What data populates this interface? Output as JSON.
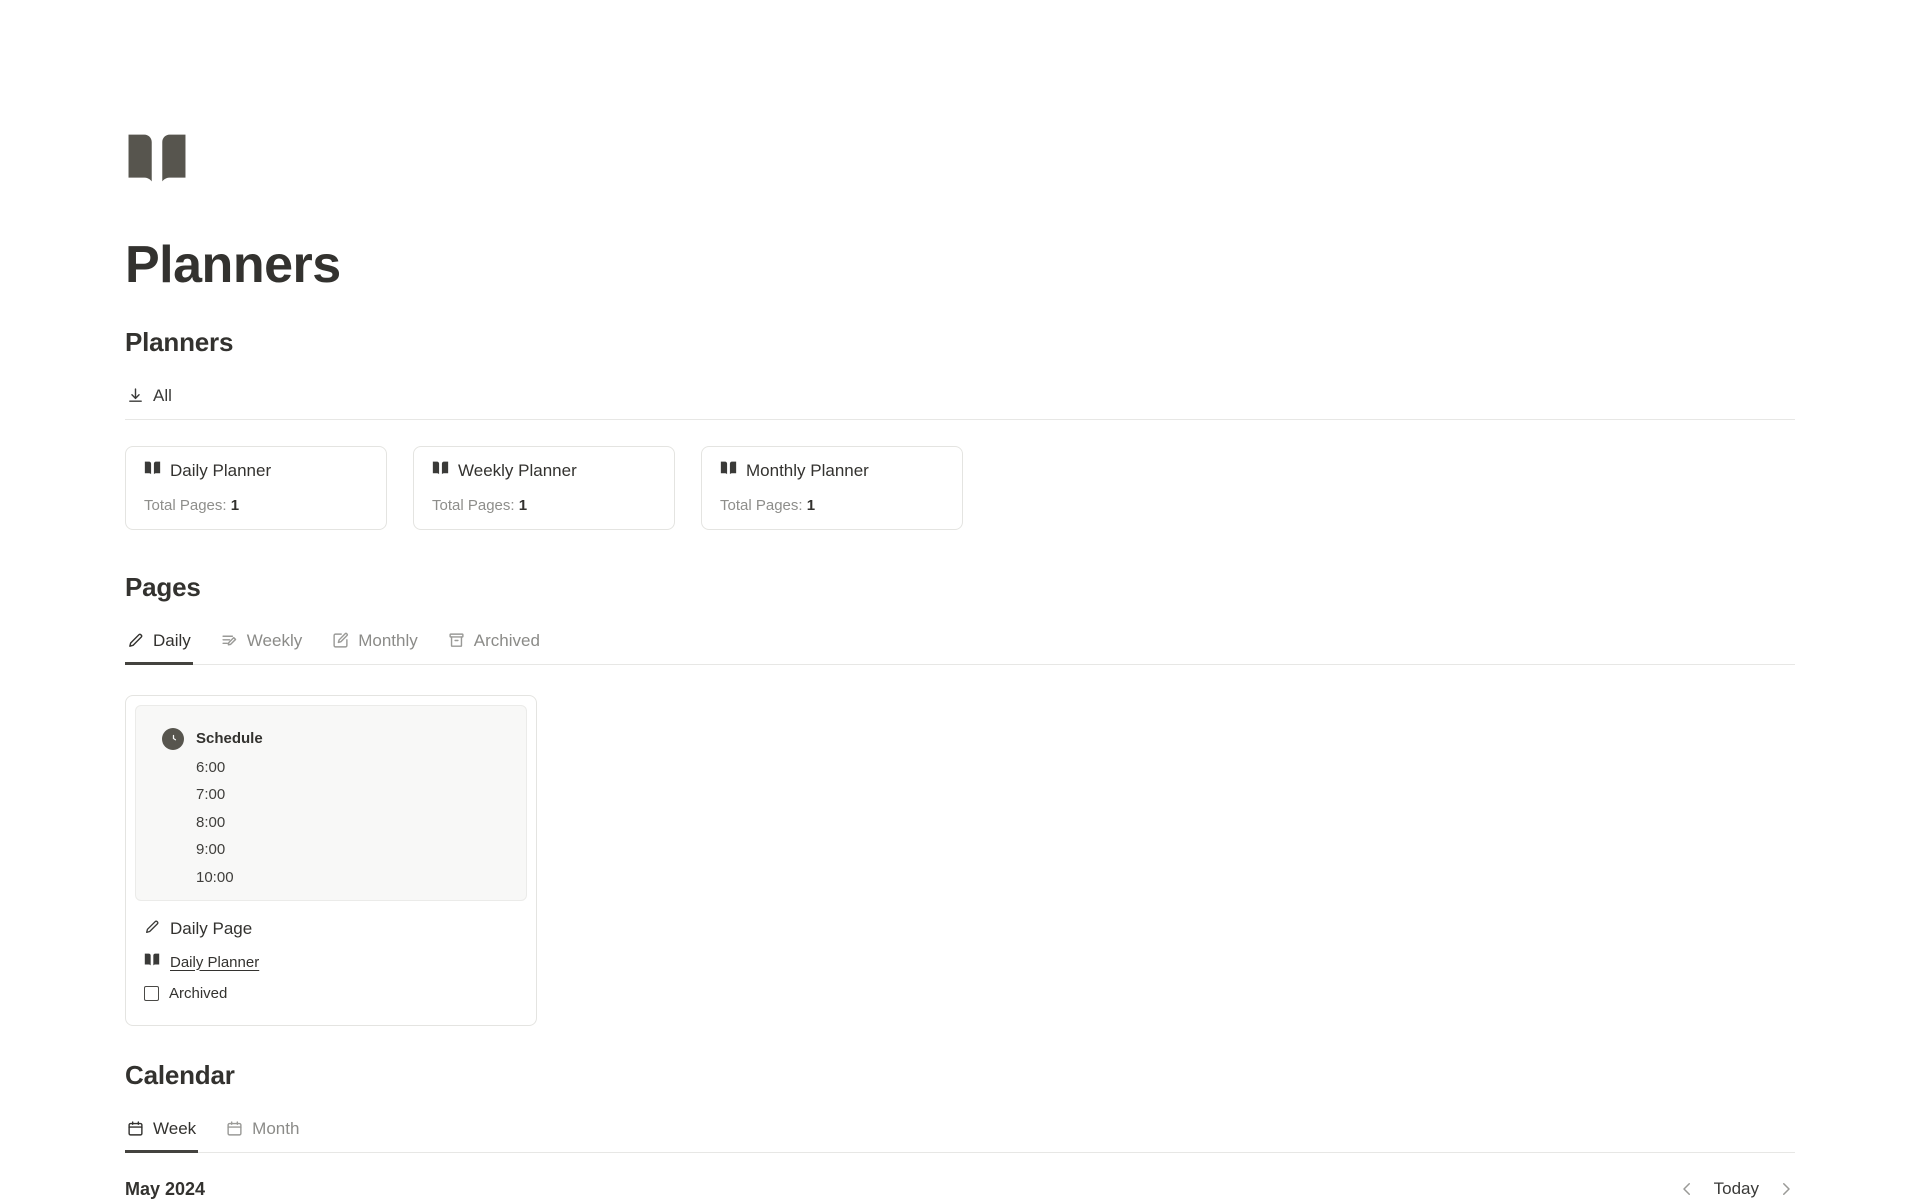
{
  "app": {
    "logo_icon": "open-book-icon",
    "title": "Planners",
    "logo_color": "#57554E"
  },
  "planners_section": {
    "heading": "Planners",
    "filters": [
      {
        "label": "All",
        "icon": "download-icon",
        "active": true
      }
    ],
    "cards": [
      {
        "title": "Daily Planner",
        "icon": "open-book-icon",
        "meta_label": "Total Pages:",
        "meta_value": "1"
      },
      {
        "title": "Weekly Planner",
        "icon": "open-book-icon",
        "meta_label": "Total Pages:",
        "meta_value": "1"
      },
      {
        "title": "Monthly Planner",
        "icon": "open-book-icon",
        "meta_label": "Total Pages:",
        "meta_value": "1"
      }
    ]
  },
  "pages_section": {
    "heading": "Pages",
    "tabs": [
      {
        "label": "Daily",
        "icon": "pencil-icon",
        "active": true
      },
      {
        "label": "Weekly",
        "icon": "list-pen-icon",
        "active": false
      },
      {
        "label": "Monthly",
        "icon": "square-pen-icon",
        "active": false
      },
      {
        "label": "Archived",
        "icon": "archive-box-icon",
        "active": false
      }
    ],
    "page_card": {
      "preview": {
        "heading": "Schedule",
        "icon": "clock-icon",
        "slots": [
          "6:00",
          "7:00",
          "8:00",
          "9:00",
          "10:00"
        ]
      },
      "title": "Daily Page",
      "title_icon": "pencil-icon",
      "planner_link": "Daily Planner",
      "planner_icon": "open-book-icon",
      "archived_label": "Archived",
      "archived_checked": false
    }
  },
  "calendar_section": {
    "heading": "Calendar",
    "tabs": [
      {
        "label": "Week",
        "icon": "calendar-icon",
        "active": true
      },
      {
        "label": "Month",
        "icon": "calendar-icon",
        "active": false
      }
    ],
    "current_period": "May 2024",
    "nav": {
      "prev_icon": "chevron-left-icon",
      "today_label": "Today",
      "next_icon": "chevron-right-icon"
    }
  }
}
